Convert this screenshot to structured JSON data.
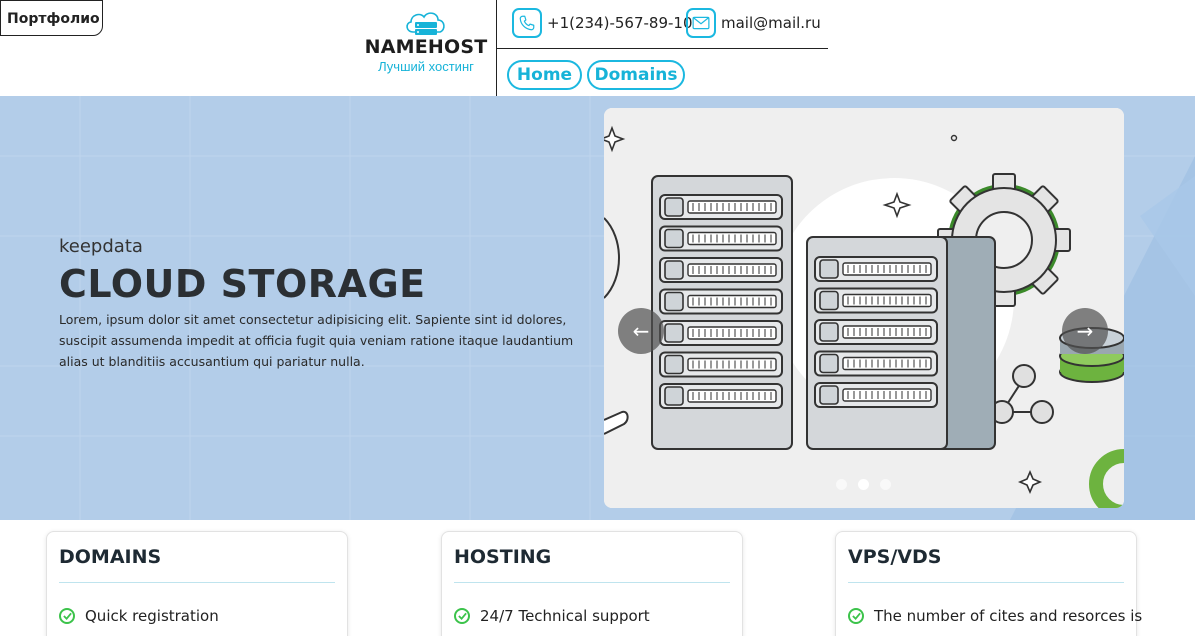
{
  "header": {
    "portfolio_label": "Портфолио",
    "logo_name": "NAMEHOST",
    "logo_tagline": "Лучший хостинг",
    "phone": "+1(234)-567-89-10",
    "email": "mail@mail.ru",
    "nav": [
      {
        "label": "Home"
      },
      {
        "label": "Domains"
      }
    ]
  },
  "hero": {
    "subtitle": "keepdata",
    "title": "CLOUD STORAGE",
    "text": "Lorem, ipsum dolor sit amet consectetur adipisicing elit. Sapiente sint id dolores, suscipit assumenda impedit at officia fugit quia veniam ratione itaque laudantium alias ut blanditiis accusantium qui pariatur nulla.",
    "prev_arrow": "←",
    "next_arrow": "→",
    "slides_count": 3,
    "active_slide": 2
  },
  "cards": [
    {
      "title": "DOMAINS",
      "items": [
        "Quick registration"
      ]
    },
    {
      "title": "HOSTING",
      "items": [
        "24/7 Technical support"
      ]
    },
    {
      "title": "VPS/VDS",
      "items": [
        "The number of cites and resorces is"
      ]
    }
  ],
  "colors": {
    "accent": "#1bb8e0",
    "hero_bg": "#b3cde9",
    "check": "#3cc34b"
  }
}
